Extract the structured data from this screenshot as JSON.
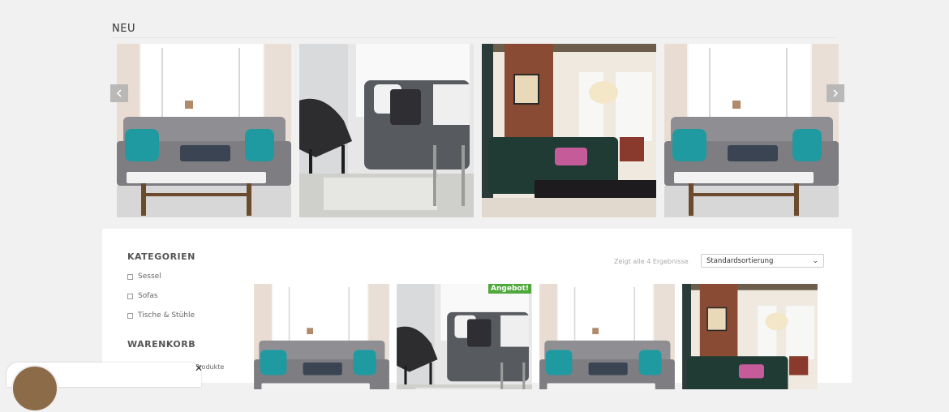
{
  "section": {
    "title": "NEU"
  },
  "carousel": {
    "prev_icon": "chevron-left-icon",
    "next_icon": "chevron-right-icon",
    "slides": [
      {
        "scene": "living-room-grey-sofa"
      },
      {
        "scene": "grey-sofa-armchair"
      },
      {
        "scene": "brick-wall-green-sofa"
      },
      {
        "scene": "living-room-grey-sofa"
      }
    ]
  },
  "sidebar": {
    "categories_title": "KATEGORIEN",
    "categories": [
      {
        "label": "Sessel"
      },
      {
        "label": "Sofas"
      },
      {
        "label": "Tische & Stühle"
      }
    ],
    "cart_title": "WARENKORB",
    "cart_snippet": "ine Produkte"
  },
  "shop": {
    "results_text": "Zeigt alle 4 Ergebnisse",
    "orderby_value": "Standardsortierung",
    "sale_badge": "Angebot!"
  },
  "colors": {
    "sale": "#4fa83a",
    "teal": "#1f9aa0"
  }
}
